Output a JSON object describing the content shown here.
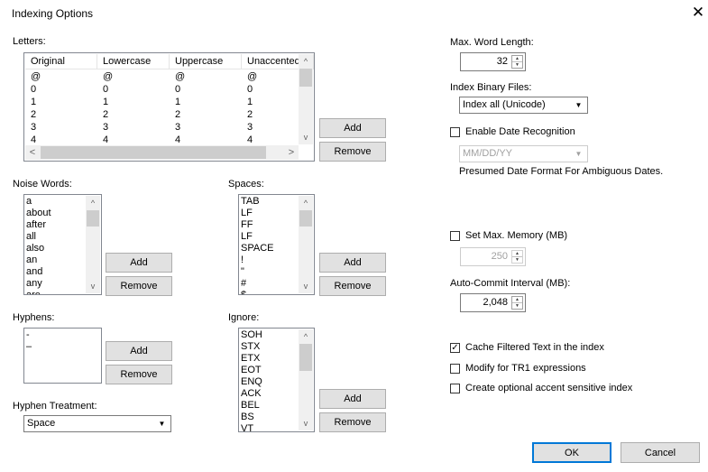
{
  "window": {
    "title": "Indexing Options",
    "close_glyph": "✕"
  },
  "letters": {
    "label": "Letters:",
    "columns": [
      "Original",
      "Lowercase",
      "Uppercase",
      "Unaccented"
    ],
    "rows": [
      [
        "@",
        "@",
        "@",
        "@"
      ],
      [
        "0",
        "0",
        "0",
        "0"
      ],
      [
        "1",
        "1",
        "1",
        "1"
      ],
      [
        "2",
        "2",
        "2",
        "2"
      ],
      [
        "3",
        "3",
        "3",
        "3"
      ],
      [
        "4",
        "4",
        "4",
        "4"
      ]
    ],
    "add_label": "Add",
    "remove_label": "Remove"
  },
  "noise_words": {
    "label": "Noise Words:",
    "items": [
      "a",
      "about",
      "after",
      "all",
      "also",
      "an",
      "and",
      "any",
      "are"
    ],
    "add_label": "Add",
    "remove_label": "Remove"
  },
  "spaces": {
    "label": "Spaces:",
    "items": [
      "TAB",
      "LF",
      "FF",
      "LF",
      "SPACE",
      "!",
      "\"",
      "#",
      "$"
    ],
    "add_label": "Add",
    "remove_label": "Remove"
  },
  "hyphens": {
    "label": "Hyphens:",
    "items": [
      "-",
      "–"
    ],
    "add_label": "Add",
    "remove_label": "Remove"
  },
  "hyphen_treatment": {
    "label": "Hyphen Treatment:",
    "value": "Space"
  },
  "ignore": {
    "label": "Ignore:",
    "items": [
      "SOH",
      "STX",
      "ETX",
      "EOT",
      "ENQ",
      "ACK",
      "BEL",
      "BS",
      "VT"
    ],
    "add_label": "Add",
    "remove_label": "Remove"
  },
  "max_word_length": {
    "label": "Max. Word Length:",
    "value": "32"
  },
  "index_binary_files": {
    "label": "Index Binary Files:",
    "value": "Index all (Unicode)"
  },
  "date_recognition": {
    "label": "Enable Date Recognition",
    "checked": false,
    "format_value": "MM/DD/YY",
    "note": "Presumed Date Format For Ambiguous Dates."
  },
  "max_memory": {
    "label": "Set Max. Memory (MB)",
    "checked": false,
    "value": "250"
  },
  "auto_commit": {
    "label": "Auto-Commit Interval (MB):",
    "value": "2,048"
  },
  "options": {
    "cache_filtered": {
      "label": "Cache Filtered Text in the index",
      "checked": true
    },
    "modify_tr1": {
      "label": "Modify for TR1 expressions",
      "checked": false
    },
    "accent_sensitive": {
      "label": "Create optional accent sensitive index",
      "checked": false
    }
  },
  "footer": {
    "ok_label": "OK",
    "cancel_label": "Cancel"
  },
  "glyphs": {
    "check": "✓",
    "up": "▲",
    "down": "▼",
    "left": "<",
    "right": ">",
    "chev_up": "^",
    "chev_down": "v"
  }
}
